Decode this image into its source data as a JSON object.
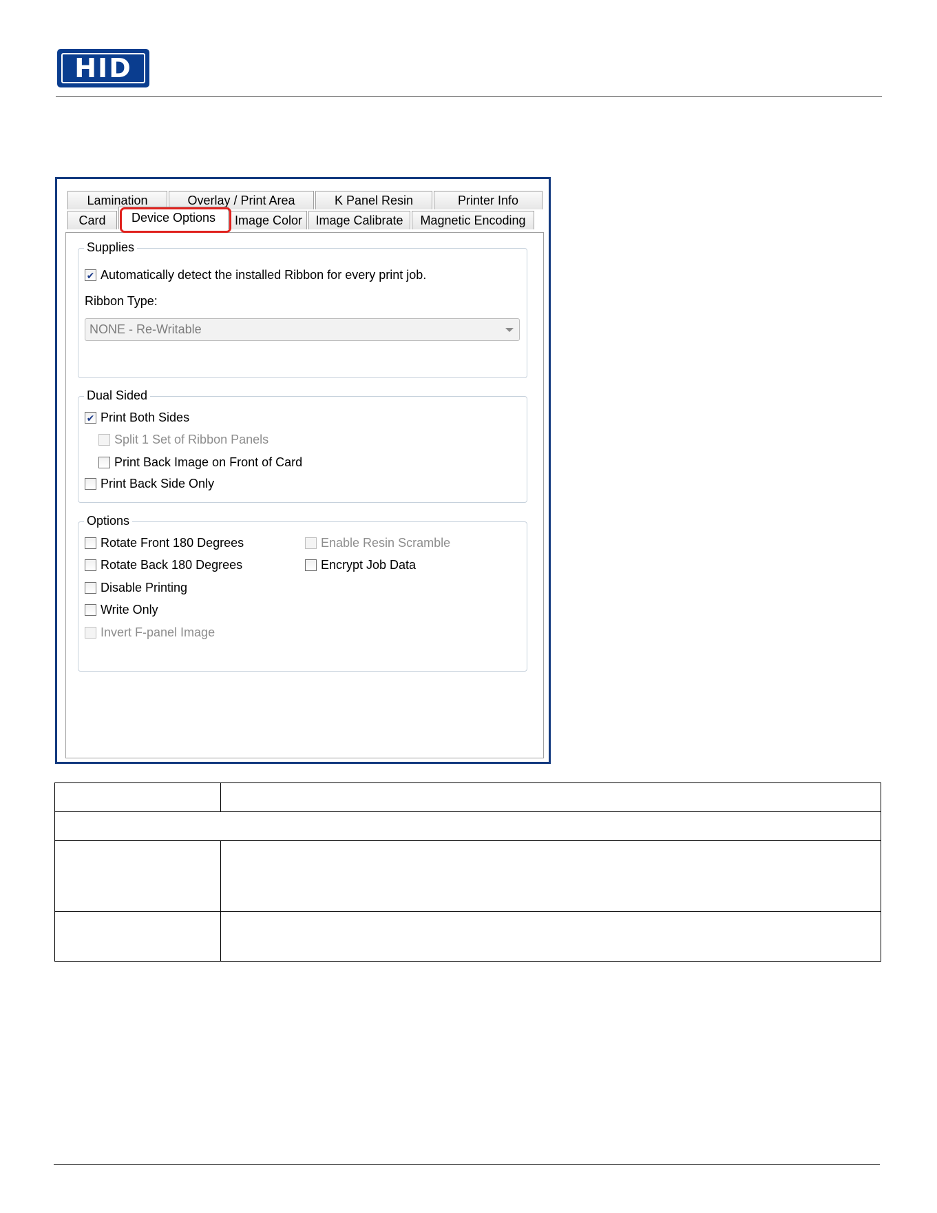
{
  "header": {
    "logo_text": "HID"
  },
  "dialog": {
    "tabs_back": [
      "Lamination",
      "Overlay / Print Area",
      "K Panel Resin",
      "Printer Info"
    ],
    "tabs_front": [
      "Card",
      "Device Options",
      "Image Color",
      "Image Calibrate",
      "Magnetic Encoding"
    ],
    "active_tab": "Device Options",
    "supplies": {
      "legend": "Supplies",
      "auto_detect": {
        "label": "Automatically detect the installed Ribbon for every print job.",
        "checked": true
      },
      "ribbon_type_label": "Ribbon Type:",
      "ribbon_type_value": "NONE - Re-Writable"
    },
    "dual_sided": {
      "legend": "Dual Sided",
      "items": [
        {
          "label": "Print Both Sides",
          "checked": true,
          "enabled": true
        },
        {
          "label": "Split 1 Set of Ribbon Panels",
          "checked": false,
          "enabled": false
        },
        {
          "label": "Print Back Image on Front of Card",
          "checked": false,
          "enabled": true
        },
        {
          "label": "Print Back Side Only",
          "checked": false,
          "enabled": true
        }
      ]
    },
    "options": {
      "legend": "Options",
      "left": [
        {
          "label": "Rotate Front 180 Degrees",
          "checked": false,
          "enabled": true
        },
        {
          "label": "Rotate Back 180 Degrees",
          "checked": false,
          "enabled": true
        },
        {
          "label": "Disable Printing",
          "checked": false,
          "enabled": true
        },
        {
          "label": "Write Only",
          "checked": false,
          "enabled": true
        },
        {
          "label": "Invert F-panel Image",
          "checked": false,
          "enabled": false
        }
      ],
      "right": [
        {
          "label": "Enable Resin Scramble",
          "checked": false,
          "enabled": false
        },
        {
          "label": "Encrypt Job Data",
          "checked": false,
          "enabled": true
        }
      ]
    },
    "highlight_color": "#e0211d",
    "frame_color": "#133a7f"
  }
}
